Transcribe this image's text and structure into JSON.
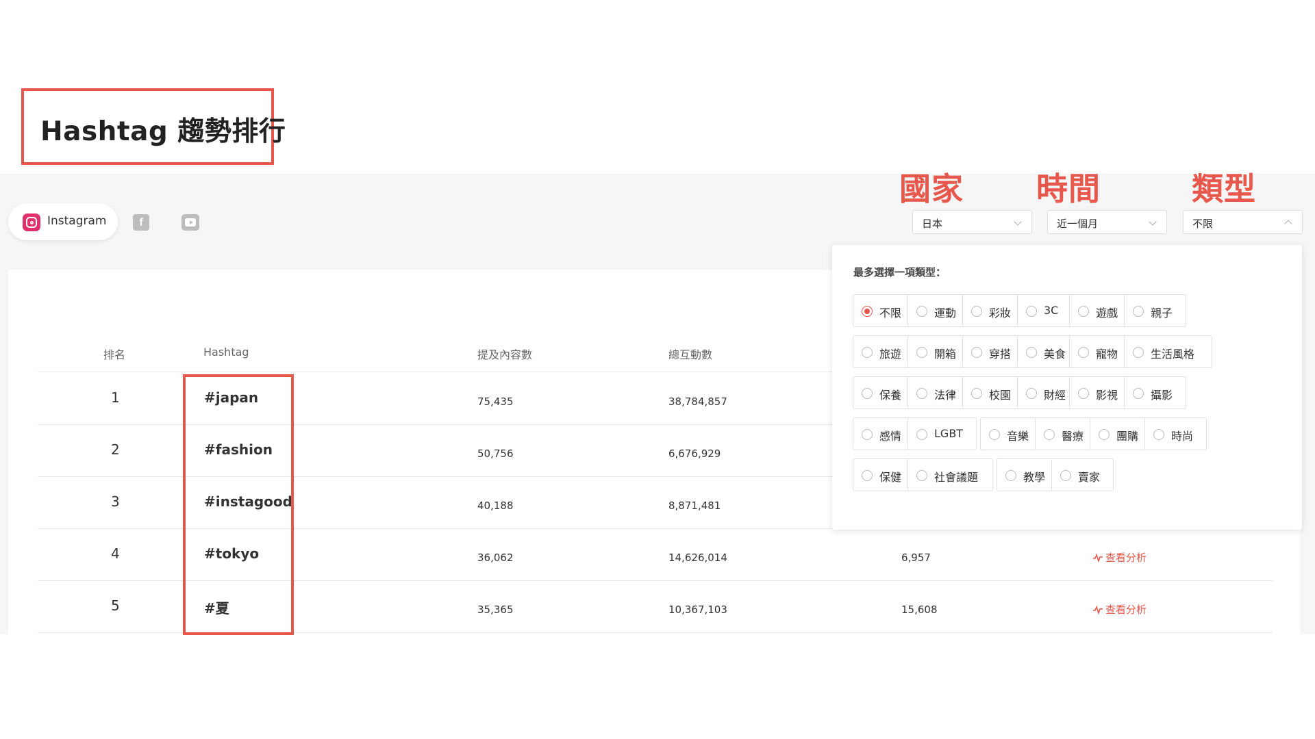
{
  "page": {
    "title": "Hashtag 趨勢排行"
  },
  "platforms": {
    "instagram_label": "Instagram",
    "facebook_glyph": "f",
    "icons": [
      "instagram-icon",
      "facebook-icon",
      "youtube-icon"
    ]
  },
  "filters": {
    "country": {
      "annotation": "國家",
      "value": "日本"
    },
    "period": {
      "annotation": "時間",
      "value": "近一個月"
    },
    "category": {
      "annotation": "類型",
      "value": "不限"
    }
  },
  "category_dropdown": {
    "title": "最多選擇一項類型：",
    "selected": "不限",
    "options": [
      "不限",
      "運動",
      "彩妝",
      "3C",
      "遊戲",
      "親子",
      "旅遊",
      "開箱",
      "穿搭",
      "美食",
      "寵物",
      "生活風格",
      "保養",
      "法律",
      "校園",
      "財經",
      "影視",
      "攝影",
      "感情",
      "LGBT",
      "音樂",
      "醫療",
      "團購",
      "時尚",
      "保健",
      "社會議題",
      "教學",
      "賣家"
    ]
  },
  "table": {
    "headers": {
      "rank": "排名",
      "hashtag": "Hashtag",
      "mentions": "提及內容數",
      "interactions": "總互動數"
    },
    "analyze_label": "查看分析",
    "rows": [
      {
        "rank": "1",
        "hashtag": "#japan",
        "mentions": "75,435",
        "interactions": "38,784,857",
        "avg": "",
        "analyze": ""
      },
      {
        "rank": "2",
        "hashtag": "#fashion",
        "mentions": "50,756",
        "interactions": "6,676,929",
        "avg": "",
        "analyze": ""
      },
      {
        "rank": "3",
        "hashtag": "#instagood",
        "mentions": "40,188",
        "interactions": "8,871,481",
        "avg": "",
        "analyze": ""
      },
      {
        "rank": "4",
        "hashtag": "#tokyo",
        "mentions": "36,062",
        "interactions": "14,626,014",
        "avg": "6,957",
        "analyze": "查看分析"
      },
      {
        "rank": "5",
        "hashtag": "#夏",
        "mentions": "35,365",
        "interactions": "10,367,103",
        "avg": "15,608",
        "analyze": "查看分析"
      }
    ]
  },
  "colors": {
    "accent": "#e8574c",
    "instagram": "#e1306c",
    "muted_icon": "#bdbdbd",
    "band": "#f6f6f6"
  }
}
